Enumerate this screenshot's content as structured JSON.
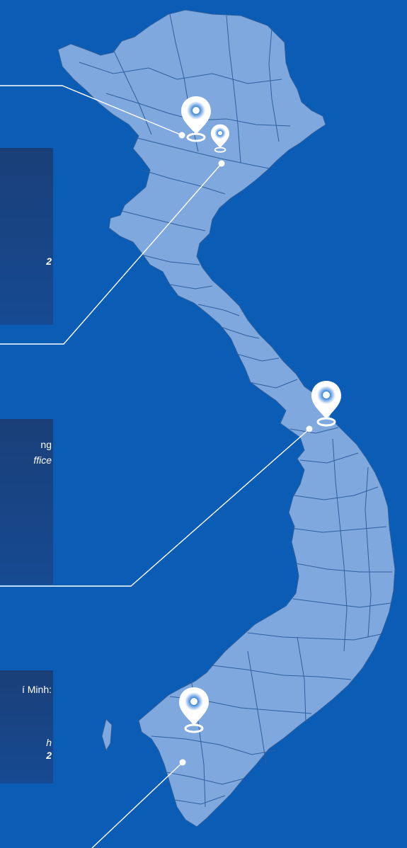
{
  "colors": {
    "background": "#0a5cb4",
    "land": "#7fa9de",
    "border": "#2f5f9e",
    "panel": "#173f7c",
    "leader_line": "#ffffff"
  },
  "panels": [
    {
      "name": "hanoi-panel",
      "lines": [
        {
          "text": "2",
          "style": "bold-italic"
        }
      ]
    },
    {
      "name": "danang-panel",
      "lines": [
        {
          "text": "ng",
          "style": "regular"
        },
        {
          "text": "ffice",
          "style": "italic"
        }
      ]
    },
    {
      "name": "hcm-panel",
      "lines": [
        {
          "text": "í Minh:",
          "style": "regular"
        },
        {
          "text": "h",
          "style": "italic"
        },
        {
          "text": "2",
          "style": "bold-italic"
        }
      ]
    }
  ],
  "markers": [
    {
      "name": "hanoi-pin",
      "icon": "map-pin-icon"
    },
    {
      "name": "haiphong-pin",
      "icon": "map-pin-icon"
    },
    {
      "name": "danang-pin",
      "icon": "map-pin-icon"
    },
    {
      "name": "hochiminh-pin",
      "icon": "map-pin-icon"
    }
  ]
}
